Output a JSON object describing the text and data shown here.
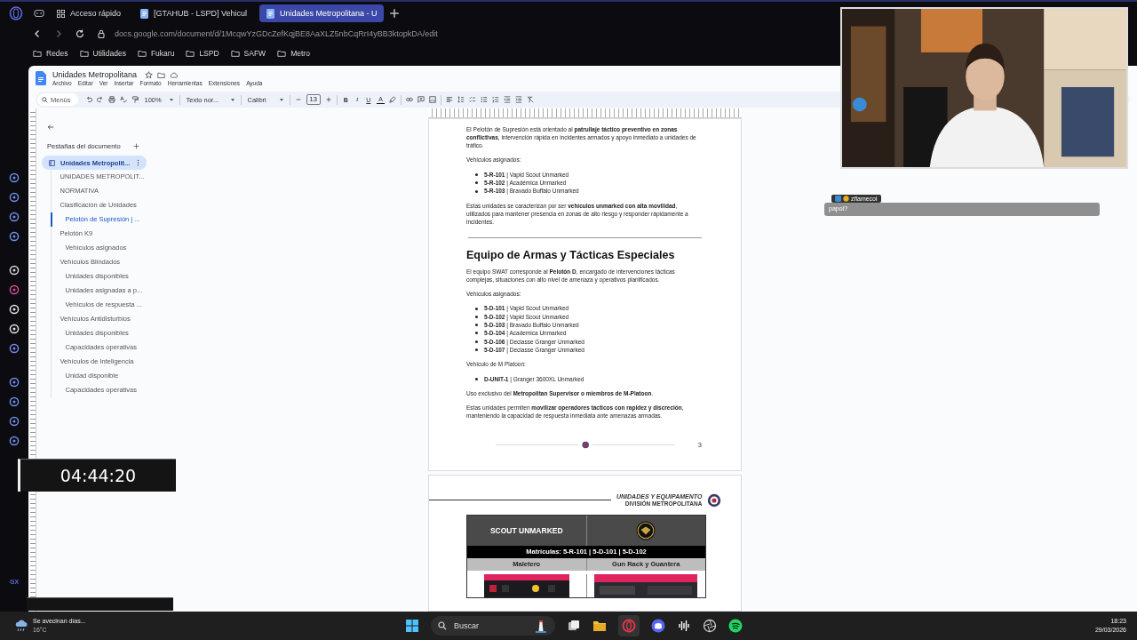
{
  "browser": {
    "tabs": [
      {
        "label": "Acceso rápido",
        "kind": "speeddial",
        "selected": false
      },
      {
        "label": "[GTAHUB - LSPD] Vehicul",
        "kind": "doc",
        "selected": false
      },
      {
        "label": "Unidades Metropolitana - U",
        "kind": "doc",
        "selected": true
      }
    ],
    "url": "docs.google.com/document/d/1McqwYzGDcZefKqjBE8AaXLZ5nbCqRrI4yBB3ktopkDA/edit",
    "bookmarks": [
      "Redes",
      "Utilidades",
      "Fukaru",
      "LSPD",
      "SAFW",
      "Metro"
    ],
    "brand_label": "GX"
  },
  "doc": {
    "title": "Unidades Metropolitana",
    "menu": [
      "Archivo",
      "Editar",
      "Ver",
      "Insertar",
      "Formato",
      "Herramientas",
      "Extensiones",
      "Ayuda"
    ],
    "toolbar": {
      "search": "Menús",
      "zoom": "100%",
      "style": "Texto nor...",
      "font": "Calibri",
      "size": "13",
      "format_keys": [
        "B",
        "I",
        "U",
        "A"
      ]
    }
  },
  "outline": {
    "title": "Pestañas del documento",
    "tab": {
      "label": "Unidades Metropolit...",
      "selected": true
    },
    "items": [
      {
        "label": "UNIDADES METROPOLIT...",
        "selected": false
      },
      {
        "label": "NORMATIVA",
        "selected": false
      },
      {
        "label": "Clasificación de Unidades",
        "selected": false,
        "children": [
          {
            "label": "Pelotón de Supresión | ...",
            "selected": true
          }
        ]
      },
      {
        "label": "Pelotón K9",
        "selected": false,
        "children": [
          {
            "label": "Vehículos asignados",
            "selected": false
          }
        ]
      },
      {
        "label": "Vehículos Blindados",
        "selected": false,
        "children": [
          {
            "label": "Unidades disponibles",
            "selected": false
          },
          {
            "label": "Unidades asignadas a p...",
            "selected": false
          },
          {
            "label": "Vehículos de respuesta ...",
            "selected": false
          }
        ]
      },
      {
        "label": "Vehículos Antidisturbios",
        "selected": false,
        "children": [
          {
            "label": "Unidades disponibles",
            "selected": false
          },
          {
            "label": "Capacidades operativas",
            "selected": false
          }
        ]
      },
      {
        "label": "Vehículos de Inteligencia",
        "selected": false,
        "children": [
          {
            "label": "Unidad disponible",
            "selected": false
          },
          {
            "label": "Capacidades operativas",
            "selected": false
          }
        ]
      }
    ]
  },
  "page": {
    "blocks": [
      {
        "kind": "paragraph",
        "text": "El Pelotón de Supresión está orientado al **patrullaje táctico preventivo en zonas conflictivas**, intervención rápida en incidentes armados y apoyo inmediato a unidades de tráfico."
      },
      {
        "kind": "paragraph",
        "text": "Vehículos asignados:"
      },
      {
        "kind": "list",
        "items": [
          "**5-R-101** | Vapid Scout Unmarked",
          "**5-R-102** | Académica Unmarked",
          "**5-R-103** | Bravado Buffalo Unmarked"
        ]
      },
      {
        "kind": "paragraph",
        "text": "Estas unidades se caracterizan por ser **vehículos unmarked con alta movilidad**, utilizados para mantener presencia en zonas de alto riesgo y responder rápidamente a incidentes."
      },
      {
        "kind": "rule"
      },
      {
        "kind": "heading",
        "text": "Equipo de Armas y Tácticas Especiales"
      },
      {
        "kind": "paragraph",
        "text": "El equipo SWAT corresponde al **Pelotón D**, encargado de intervenciones tácticas complejas, situaciones con alto nivel de amenaza y operativos planificados."
      },
      {
        "kind": "paragraph",
        "text": "Vehículos asignados:"
      },
      {
        "kind": "list",
        "items": [
          "**5-D-101** | Vapid Scout Unmarked",
          "**5-D-102** | Vapid Scout Unmarked",
          "**5-D-103** | Bravado Buffalo Unmarked",
          "**5-D-104** | Academica Unmarked",
          "**5-D-106** | Declasse Granger Unmarked",
          "**5-D-107** | Declasse Granger Unmarked"
        ]
      },
      {
        "kind": "paragraph",
        "text": "Vehículo de M Platoon:"
      },
      {
        "kind": "list",
        "items": [
          "**D-UNIT-1** | Granger 3600XL Unmarked"
        ]
      },
      {
        "kind": "paragraph",
        "text": "Uso exclusivo del **Metropolitan Supervisor o miembros de M-Platoon**."
      },
      {
        "kind": "paragraph",
        "text": "Estas unidades permiten **movilizar operadores tácticos con rapidez y discreción**, manteniendo la capacidad de respuesta inmediata ante amenazas armadas."
      }
    ],
    "page_number": "3"
  },
  "page2": {
    "header_title": "UNIDADES Y EQUIPAMENTO",
    "header_subtitle": "DIVISIÓN METROPOLITANA",
    "card_title": "SCOUT UNMARKED",
    "plates": "Matrículas: 5-R-101 | 5-D-101 | 5-D-102",
    "columns": [
      "Maletero",
      "Gun Rack y Guantera"
    ]
  },
  "stream": {
    "timer": "04:44:20",
    "chat": {
      "user": "zflamecol",
      "message": "papoi?"
    }
  },
  "taskbar": {
    "weather": "Se avecinan días...",
    "temperature": "16°C",
    "search": "Buscar",
    "time": "18:23",
    "date": "29/03/2026"
  }
}
